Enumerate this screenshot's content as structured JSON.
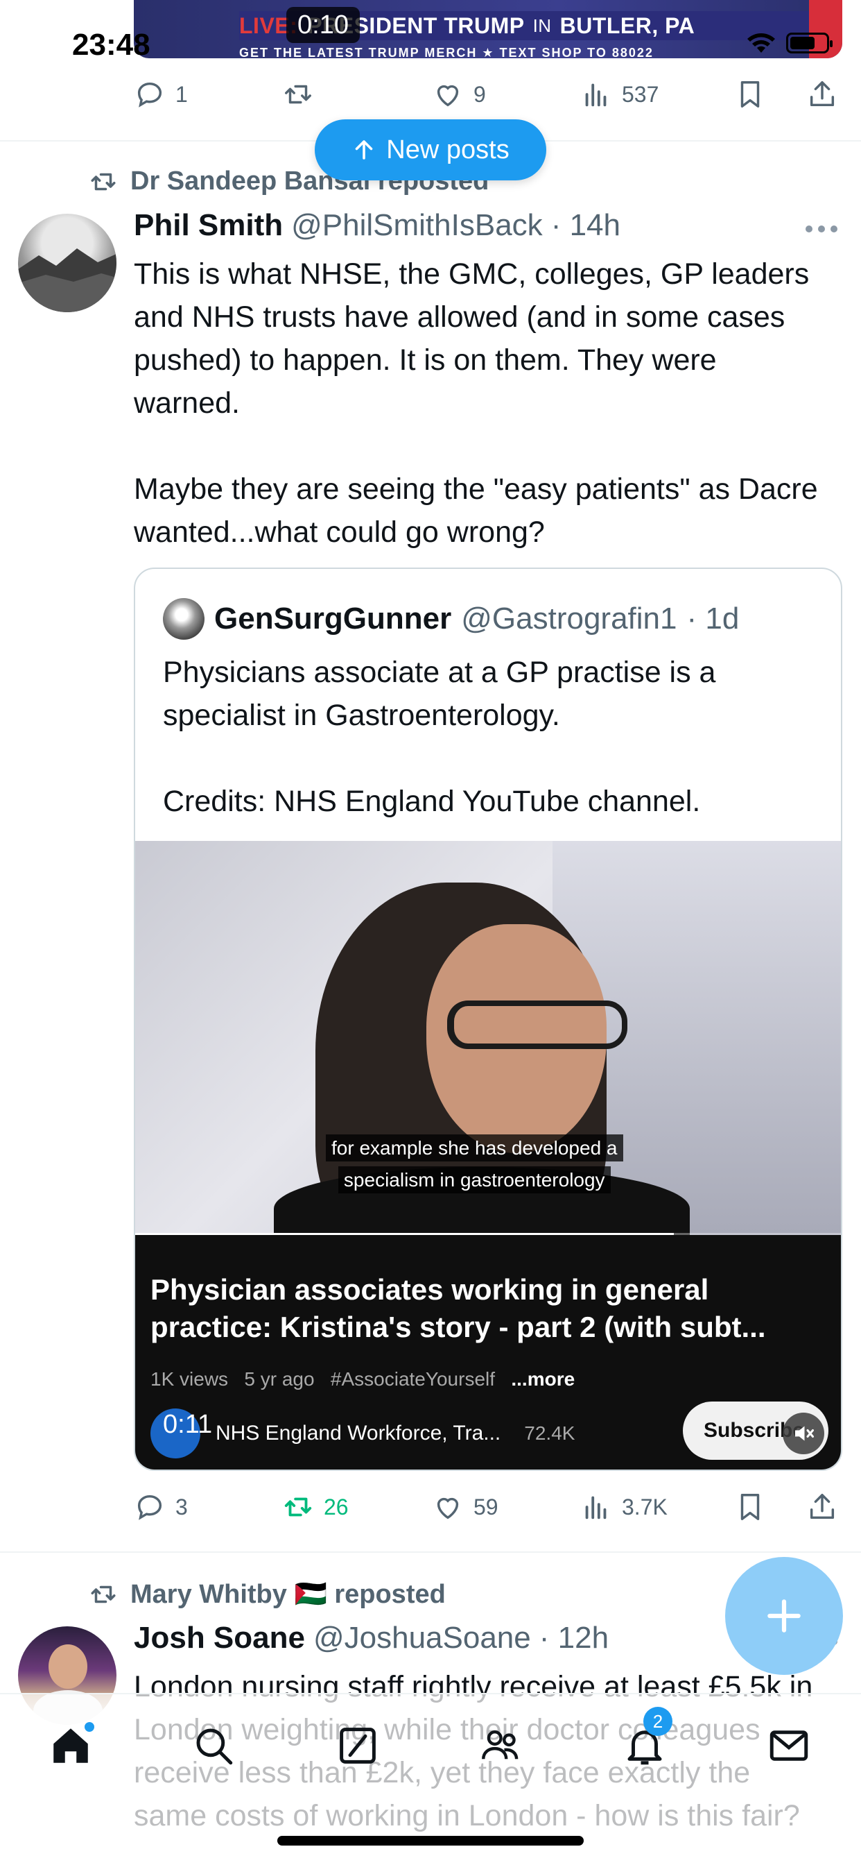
{
  "status_bar": {
    "time": "23:48"
  },
  "top_video": {
    "timer": "0:10",
    "live_label": "LIVE:",
    "banner_a": "PRESIDENT TRUMP",
    "banner_in": "IN",
    "banner_b": "BUTLER, PA",
    "merch_text": "GET THE LATEST TRUMP MERCH  ★  TEXT SHOP TO 88022"
  },
  "prev_tweet_actions": {
    "replies": "1",
    "reposts": "",
    "likes": "9",
    "views": "537"
  },
  "new_posts": {
    "label": "New posts"
  },
  "tweet1": {
    "reposted_by": "Dr Sandeep Bansal reposted",
    "name": "Phil Smith",
    "handle": "@PhilSmithIsBack",
    "time": "· 14h",
    "text_p1": "This is what NHSE, the GMC, colleges, GP leaders and NHS trusts have allowed (and in some cases pushed) to happen. It is on them. They were warned.",
    "text_p2": "Maybe they are seeing the \"easy patients\" as Dacre wanted...what could go wrong?",
    "quote": {
      "name": "GenSurgGunner",
      "handle": "@Gastrografin1",
      "time": "· 1d",
      "text_p1": "Physicians associate at a GP practise is a specialist in Gastroenterology.",
      "text_p2": "Credits: NHS England YouTube channel.",
      "caption_line1": "for example she has developed a",
      "caption_line2": "specialism in gastroenterology",
      "video_progress": 0.76,
      "yt_title": "Physician associates working in general practice: Kristina's story - part 2 (with subt...",
      "yt_views": "1K views",
      "yt_age": "5 yr ago",
      "yt_tag": "#AssociateYourself",
      "yt_more": "...more",
      "yt_timer": "0:11",
      "yt_channel": "NHS England Workforce, Tra...",
      "yt_subs": "72.4K",
      "subscribe_label": "Subscribe"
    },
    "actions": {
      "replies": "3",
      "reposts": "26",
      "likes": "59",
      "views": "3.7K"
    }
  },
  "tweet2": {
    "reposted_by": "Mary Whitby 🇵🇸 reposted",
    "name": "Josh Soane",
    "handle": "@JoshuaSoane",
    "time": "· 12h",
    "text": "London nursing staff rightly receive at least £5.5k in London weighting, while their doctor colleagues receive less than £2k, yet they face exactly the same costs of working in London - how is this fair?"
  },
  "bottom_nav": {
    "notifications_count": "2"
  },
  "colors": {
    "accent": "#1d9bf0",
    "repost_green": "#00ba7c",
    "muted": "#536471"
  },
  "icons": [
    "reply-icon",
    "repost-icon",
    "like-icon",
    "views-icon",
    "bookmark-icon",
    "share-icon",
    "home-icon",
    "search-icon",
    "grok-icon",
    "communities-icon",
    "bell-icon",
    "mail-icon",
    "compose-icon",
    "mute-icon",
    "more-icon"
  ]
}
